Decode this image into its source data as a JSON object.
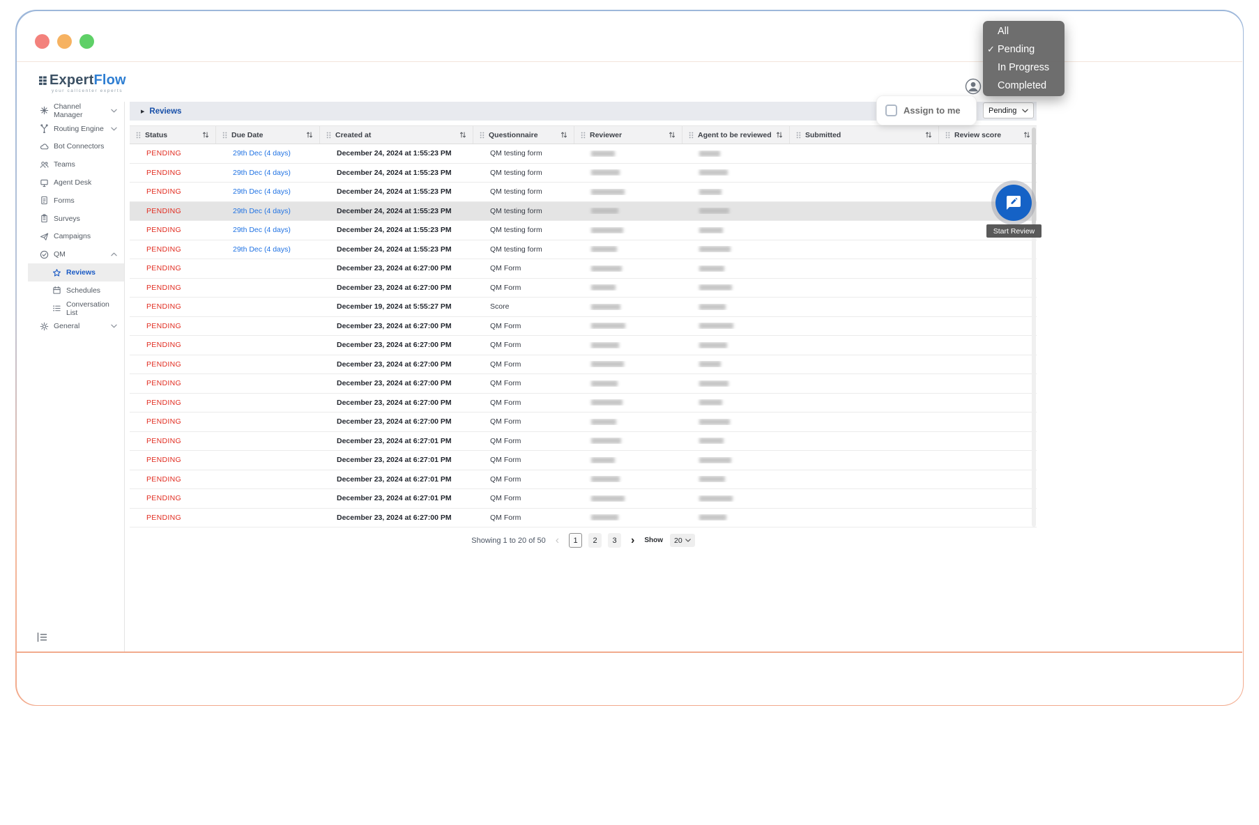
{
  "brand": {
    "name_a": "Expert",
    "name_b": "Flow",
    "tagline": "your callcenter experts"
  },
  "sidebar": {
    "items": [
      {
        "label": "Channel Manager",
        "icon": "channel-manager",
        "chevron": "down"
      },
      {
        "label": "Routing Engine",
        "icon": "routing-engine",
        "chevron": "down"
      },
      {
        "label": "Bot Connectors",
        "icon": "bot-connectors"
      },
      {
        "label": "Teams",
        "icon": "teams"
      },
      {
        "label": "Agent Desk",
        "icon": "agent-desk"
      },
      {
        "label": "Forms",
        "icon": "forms"
      },
      {
        "label": "Surveys",
        "icon": "surveys"
      },
      {
        "label": "Campaigns",
        "icon": "campaigns"
      },
      {
        "label": "QM",
        "icon": "qm",
        "chevron": "up"
      },
      {
        "label": "Reviews",
        "icon": "reviews",
        "child": true,
        "selected": true
      },
      {
        "label": "Schedules",
        "icon": "schedules",
        "child": true
      },
      {
        "label": "Conversation List",
        "icon": "conversation-list",
        "child": true
      },
      {
        "label": "General",
        "icon": "general",
        "chevron": "down"
      }
    ]
  },
  "breadcrumb": {
    "label": "Reviews"
  },
  "status_filter": {
    "value": "Pending"
  },
  "filter_menu": {
    "options": [
      {
        "label": "All"
      },
      {
        "label": "Pending",
        "checked": true
      },
      {
        "label": "In Progress"
      },
      {
        "label": "Completed"
      }
    ]
  },
  "assign_to_me": {
    "label": "Assign to me",
    "checked": false
  },
  "start_review": {
    "tooltip": "Start Review"
  },
  "table": {
    "columns": [
      "Status",
      "Due Date",
      "Created at",
      "Questionnaire",
      "Reviewer",
      "Agent to be reviewed",
      "Submitted",
      "Review score"
    ],
    "rows": [
      {
        "status": "PENDING",
        "due": "29th Dec (4 days)",
        "created": "December 24, 2024 at 1:55:23 PM",
        "questionnaire": "QM testing form"
      },
      {
        "status": "PENDING",
        "due": "29th Dec (4 days)",
        "created": "December 24, 2024 at 1:55:23 PM",
        "questionnaire": "QM testing form"
      },
      {
        "status": "PENDING",
        "due": "29th Dec (4 days)",
        "created": "December 24, 2024 at 1:55:23 PM",
        "questionnaire": "QM testing form"
      },
      {
        "status": "PENDING",
        "due": "29th Dec (4 days)",
        "created": "December 24, 2024 at 1:55:23 PM",
        "questionnaire": "QM testing form",
        "highlight": true
      },
      {
        "status": "PENDING",
        "due": "29th Dec (4 days)",
        "created": "December 24, 2024 at 1:55:23 PM",
        "questionnaire": "QM testing form"
      },
      {
        "status": "PENDING",
        "due": "29th Dec (4 days)",
        "created": "December 24, 2024 at 1:55:23 PM",
        "questionnaire": "QM testing form"
      },
      {
        "status": "PENDING",
        "due": "",
        "created": "December 23, 2024 at 6:27:00 PM",
        "questionnaire": "QM Form"
      },
      {
        "status": "PENDING",
        "due": "",
        "created": "December 23, 2024 at 6:27:00 PM",
        "questionnaire": "QM Form"
      },
      {
        "status": "PENDING",
        "due": "",
        "created": "December 19, 2024 at 5:55:27 PM",
        "questionnaire": "Score"
      },
      {
        "status": "PENDING",
        "due": "",
        "created": "December 23, 2024 at 6:27:00 PM",
        "questionnaire": "QM Form"
      },
      {
        "status": "PENDING",
        "due": "",
        "created": "December 23, 2024 at 6:27:00 PM",
        "questionnaire": "QM Form"
      },
      {
        "status": "PENDING",
        "due": "",
        "created": "December 23, 2024 at 6:27:00 PM",
        "questionnaire": "QM Form"
      },
      {
        "status": "PENDING",
        "due": "",
        "created": "December 23, 2024 at 6:27:00 PM",
        "questionnaire": "QM Form"
      },
      {
        "status": "PENDING",
        "due": "",
        "created": "December 23, 2024 at 6:27:00 PM",
        "questionnaire": "QM Form"
      },
      {
        "status": "PENDING",
        "due": "",
        "created": "December 23, 2024 at 6:27:00 PM",
        "questionnaire": "QM Form"
      },
      {
        "status": "PENDING",
        "due": "",
        "created": "December 23, 2024 at 6:27:01 PM",
        "questionnaire": "QM Form"
      },
      {
        "status": "PENDING",
        "due": "",
        "created": "December 23, 2024 at 6:27:01 PM",
        "questionnaire": "QM Form"
      },
      {
        "status": "PENDING",
        "due": "",
        "created": "December 23, 2024 at 6:27:01 PM",
        "questionnaire": "QM Form"
      },
      {
        "status": "PENDING",
        "due": "",
        "created": "December 23, 2024 at 6:27:01 PM",
        "questionnaire": "QM Form"
      },
      {
        "status": "PENDING",
        "due": "",
        "created": "December 23, 2024 at 6:27:00 PM",
        "questionnaire": "QM Form"
      }
    ]
  },
  "pagination": {
    "summary": "Showing 1 to 20 of 50",
    "pages": [
      "1",
      "2",
      "3"
    ],
    "active_page": "1",
    "show_label": "Show",
    "page_size": "20"
  }
}
